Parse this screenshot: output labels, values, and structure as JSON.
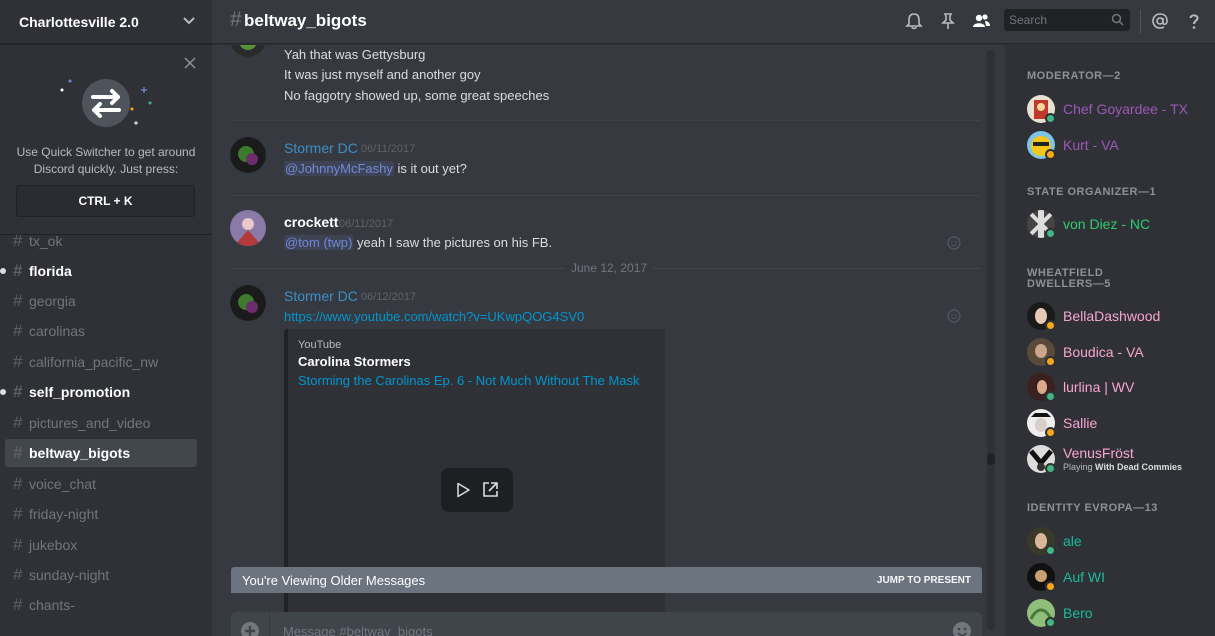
{
  "server": {
    "name": "Charlottesville 2.0"
  },
  "quick_switcher": {
    "text": "Use Quick Switcher to get around Discord quickly. Just press:",
    "shortcut": "CTRL + K"
  },
  "channels": [
    {
      "name": "tx_ok",
      "state": "normal"
    },
    {
      "name": "florida",
      "state": "unread"
    },
    {
      "name": "georgia",
      "state": "normal"
    },
    {
      "name": "carolinas",
      "state": "normal"
    },
    {
      "name": "california_pacific_nw",
      "state": "normal"
    },
    {
      "name": "self_promotion",
      "state": "unread"
    },
    {
      "name": "pictures_and_video",
      "state": "normal"
    },
    {
      "name": "beltway_bigots",
      "state": "active"
    },
    {
      "name": "voice_chat",
      "state": "normal"
    },
    {
      "name": "friday-night",
      "state": "normal"
    },
    {
      "name": "jukebox",
      "state": "normal"
    },
    {
      "name": "sunday-night",
      "state": "normal"
    },
    {
      "name": "chants-",
      "state": "normal"
    }
  ],
  "channel_header": {
    "hash": "#",
    "name": "beltway_bigots",
    "search_placeholder": "Search"
  },
  "messages": {
    "m1": {
      "lines": [
        "Yah that was Gettysburg",
        "It was just myself and another goy",
        "No faggotry showed up, some great speeches"
      ]
    },
    "m2": {
      "author": "Stormer DC",
      "timestamp": "06/11/2017",
      "mention": "@JohnnyMcFashy",
      "text": " is it out yet?"
    },
    "m3": {
      "author": "crockett",
      "timestamp": "06/11/2017",
      "mention": "@tom (twp)",
      "text": "  yeah I saw the pictures on his FB."
    },
    "date_divider": "June 12, 2017",
    "m4": {
      "author": "Stormer DC",
      "timestamp": "06/12/2017",
      "link": "https://www.youtube.com/watch?v=UKwpQOG4SV0",
      "embed": {
        "provider": "YouTube",
        "author": "Carolina Stormers",
        "title": "Storming the Carolinas Ep. 6 - Not Much Without The Mask"
      }
    }
  },
  "older_messages_bar": {
    "label": "You're Viewing Older Messages",
    "jump": "JUMP TO PRESENT"
  },
  "composer": {
    "placeholder": "Message #beltway_bigots"
  },
  "member_list": {
    "sections": [
      {
        "title": "MODERATOR—2",
        "members": [
          {
            "name": "Chef Goyardee - TX",
            "color": "#9b59b6",
            "status": "online"
          },
          {
            "name": "Kurt - VA",
            "color": "#9b59b6",
            "status": "idle"
          }
        ]
      },
      {
        "title": "STATE ORGANIZER—1",
        "members": [
          {
            "name": "von Diez - NC",
            "color": "#2ecc71",
            "status": "online"
          }
        ]
      },
      {
        "title": "WHEATFIELD DWELLERS—5",
        "members": [
          {
            "name": "BellaDashwood",
            "color": "#f8a5d1",
            "status": "idle"
          },
          {
            "name": "Boudica - VA",
            "color": "#f8a5d1",
            "status": "idle"
          },
          {
            "name": "lurlina | WV",
            "color": "#f8a5d1",
            "status": "online"
          },
          {
            "name": "Sallie",
            "color": "#f8a5d1",
            "status": "idle"
          },
          {
            "name": "VenusFröst",
            "color": "#f8a5d1",
            "status": "online",
            "activity_prefix": "Playing ",
            "activity": "With Dead Commies"
          }
        ]
      },
      {
        "title": "IDENTITY EVROPA—13",
        "members": [
          {
            "name": "ale",
            "color": "#1abc9c",
            "status": "online"
          },
          {
            "name": "Auf WI",
            "color": "#1abc9c",
            "status": "idle"
          },
          {
            "name": "Bero",
            "color": "#1abc9c",
            "status": "online"
          }
        ]
      }
    ]
  },
  "colors": {
    "stormer_dc": "#3a8fc6",
    "link": "#0096cf",
    "online": "#43b581",
    "idle": "#faa61a"
  }
}
